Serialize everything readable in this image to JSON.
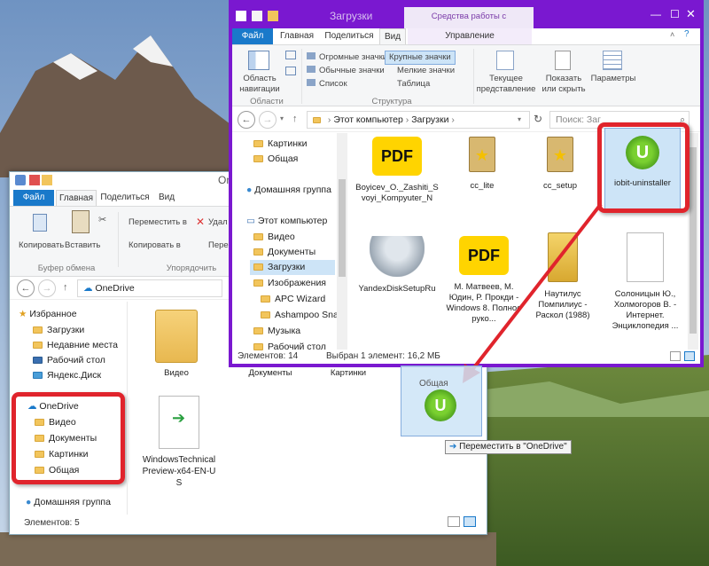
{
  "colors": {
    "accent": "#1979ca",
    "purple_frame": "#7a18d0",
    "annotation_red": "#e0242c",
    "tooltip_bg": "#f4f4f4"
  },
  "front": {
    "title": "Загрузки",
    "context_tab": "Средства работы с приложениями",
    "tabs": [
      "Файл",
      "Главная",
      "Поделиться",
      "Вид",
      "Управление"
    ],
    "ribbon": {
      "nav_pane_label": "Область навигации",
      "layout_items": [
        "Огромные значки",
        "Обычные значки",
        "Список",
        "Крупные значки",
        "Мелкие значки",
        "Таблица"
      ],
      "current_view_label": "Текущее представление",
      "show_hide_label": "Показать или скрыть",
      "options_label": "Параметры",
      "group_areas": "Области",
      "group_structure": "Структура"
    },
    "address": {
      "segments": [
        "Этот компьютер",
        "Загрузки"
      ],
      "search_placeholder": "Поиск: Заг"
    },
    "nav": [
      "Картинки",
      "Общая",
      "Домашняя группа",
      "Этот компьютер",
      "Видео",
      "Документы",
      "Загрузки",
      "Изображения",
      "APC Wizard",
      "Ashampoo Snap",
      "Музыка",
      "Рабочий стол"
    ],
    "files": [
      {
        "name": "Boyicev_O._Zashiti_Svoyi_Kompyuter_N",
        "icon": "pdf-icon"
      },
      {
        "name": "cc_lite",
        "icon": "installer-icon"
      },
      {
        "name": "cc_setup",
        "icon": "installer-icon"
      },
      {
        "name": "iobit-uninstaller",
        "icon": "uninstaller-icon"
      },
      {
        "name": "YandexDiskSetupRu",
        "icon": "ufo-icon"
      },
      {
        "name": "М. Матвеев, М. Юдин, Р. Прокди - Windows 8. Полное руко...",
        "icon": "pdf-icon"
      },
      {
        "name": "Наутилус Помпилиус - Раскол (1988)",
        "icon": "zip-icon"
      },
      {
        "name": "Солоницын Ю., Холмогоров В. - Интернет. Энциклопедия ...",
        "icon": "doc-icon"
      }
    ],
    "status": {
      "count": "Элементов: 14",
      "selected": "Выбран 1 элемент: 16,2 МБ"
    }
  },
  "back": {
    "title": "OneDrive",
    "tabs": [
      "Файл",
      "Главная",
      "Поделиться",
      "Вид"
    ],
    "ribbon": {
      "copy": "Копировать",
      "paste": "Вставить",
      "move_to": "Переместить в",
      "copy_to": "Копировать в",
      "delete": "Удал",
      "rename": "Пере",
      "group_clipboard": "Буфер обмена",
      "group_organize": "Упорядочить"
    },
    "address": "OneDrive",
    "nav": [
      "Избранное",
      "Загрузки",
      "Недавние места",
      "Рабочий стол",
      "Яндекс.Диск",
      "OneDrive",
      "Видео",
      "Документы",
      "Картинки",
      "Общая",
      "Домашняя группа"
    ],
    "files": [
      "Видео",
      "Документы",
      "Картинки",
      "WindowsTechnicalPreview-x64-EN-US"
    ],
    "status": "Элементов: 5"
  },
  "drag": {
    "folder_label": "Общая",
    "tooltip": "Переместить в \"OneDrive\""
  }
}
